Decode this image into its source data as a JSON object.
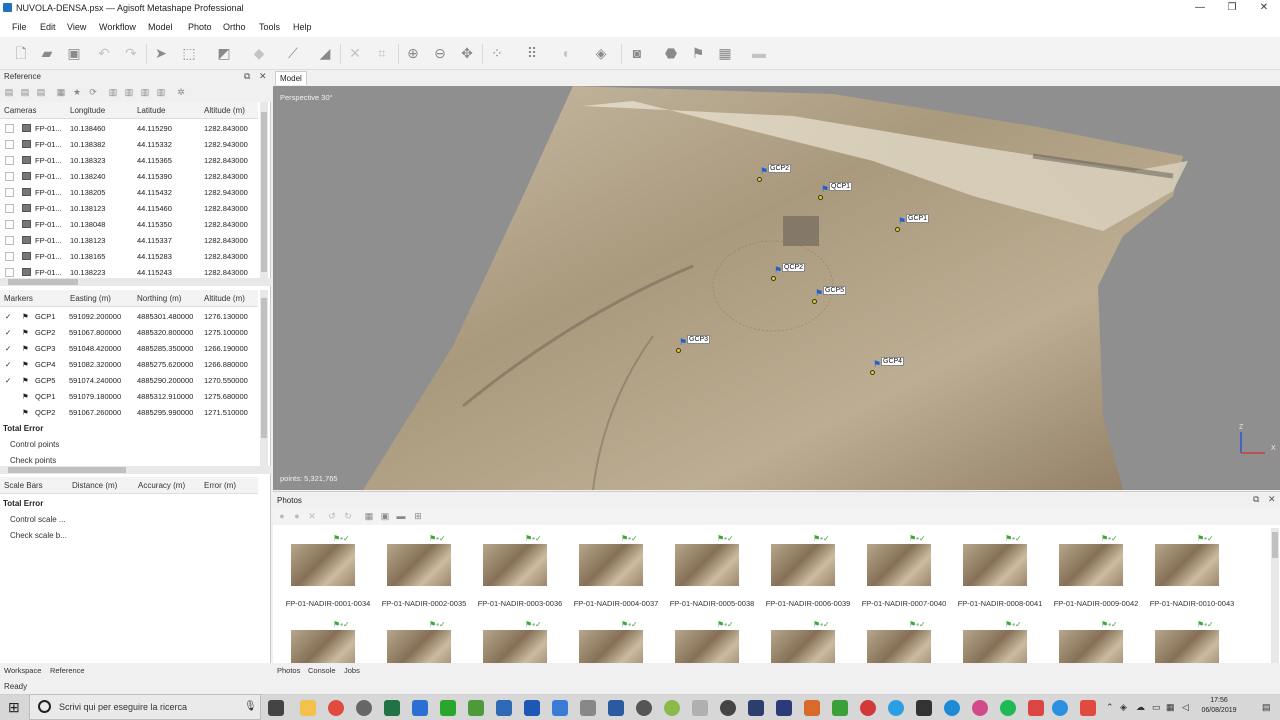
{
  "window": {
    "title": "NUVOLA-DENSA.psx — Agisoft Metashape Professional",
    "minimize": "—",
    "restore": "❐",
    "close": "✕"
  },
  "menu": [
    "File",
    "Edit",
    "View",
    "Workflow",
    "Model",
    "Photo",
    "Ortho",
    "Tools",
    "Help"
  ],
  "reference_panel": {
    "title": "Reference",
    "cameras": {
      "headers": [
        "Cameras",
        "Longitude",
        "Latitude",
        "Altitude (m)"
      ],
      "rows": [
        [
          "FP-01...",
          "10.138460",
          "44.115290",
          "1282.843000"
        ],
        [
          "FP-01...",
          "10.138382",
          "44.115332",
          "1282.943000"
        ],
        [
          "FP-01...",
          "10.138323",
          "44.115365",
          "1282.843000"
        ],
        [
          "FP-01...",
          "10.138240",
          "44.115390",
          "1282.843000"
        ],
        [
          "FP-01...",
          "10.138205",
          "44.115432",
          "1282.943000"
        ],
        [
          "FP-01...",
          "10.138123",
          "44.115460",
          "1282.843000"
        ],
        [
          "FP-01...",
          "10.138048",
          "44.115350",
          "1282.843000"
        ],
        [
          "FP-01...",
          "10.138123",
          "44.115337",
          "1282.843000"
        ],
        [
          "FP-01...",
          "10.138165",
          "44.115283",
          "1282.843000"
        ],
        [
          "FP-01...",
          "10.138223",
          "44.115243",
          "1282.843000"
        ]
      ]
    },
    "markers": {
      "headers": [
        "Markers",
        "Easting (m)",
        "Northing (m)",
        "Altitude (m)"
      ],
      "rows": [
        {
          "checked": true,
          "name": "GCP1",
          "easting": "591092.200000",
          "northing": "4885301.480000",
          "altitude": "1276.130000"
        },
        {
          "checked": true,
          "name": "GCP2",
          "easting": "591067.800000",
          "northing": "4885320.800000",
          "altitude": "1275.100000"
        },
        {
          "checked": true,
          "name": "GCP3",
          "easting": "591048.420000",
          "northing": "4885285.350000",
          "altitude": "1266.190000"
        },
        {
          "checked": true,
          "name": "GCP4",
          "easting": "591082.320000",
          "northing": "4885275.620000",
          "altitude": "1266.880000"
        },
        {
          "checked": true,
          "name": "GCP5",
          "easting": "591074.240000",
          "northing": "4885290.200000",
          "altitude": "1270.550000"
        },
        {
          "checked": false,
          "name": "QCP1",
          "easting": "591079.180000",
          "northing": "4885312.910000",
          "altitude": "1275.680000"
        },
        {
          "checked": false,
          "name": "QCP2",
          "easting": "591067.260000",
          "northing": "4885295.990000",
          "altitude": "1271.510000"
        }
      ],
      "total_error": "Total Error",
      "control_points": "Control points",
      "check_points": "Check points"
    },
    "scalebars": {
      "headers": [
        "Scale Bars",
        "Distance (m)",
        "Accuracy (m)",
        "Error (m)"
      ],
      "total_error": "Total Error",
      "control_scale": "Control scale ...",
      "check_scale": "Check scale b..."
    }
  },
  "left_tabs": [
    "Workspace",
    "Reference"
  ],
  "status": "Ready",
  "model": {
    "tab": "Model",
    "perspective": "Perspective 30°",
    "points": "points: 5,321,765",
    "axis_z": "Z",
    "axis_x": "X",
    "markers": [
      "GCP2",
      "QCP1",
      "GCP1",
      "QCP2",
      "GCP5",
      "GCP3",
      "GCP4"
    ]
  },
  "photos": {
    "title": "Photos",
    "thumbnails": [
      "FP-01-NADIR-0001-0034",
      "FP-01-NADIR-0002-0035",
      "FP-01-NADIR-0003-0036",
      "FP-01-NADIR-0004-0037",
      "FP-01-NADIR-0005-0038",
      "FP-01-NADIR-0006-0039",
      "FP-01-NADIR-0007-0040",
      "FP-01-NADIR-0008-0041",
      "FP-01-NADIR-0009-0042",
      "FP-01-NADIR-0010-0043"
    ],
    "tabs": [
      "Photos",
      "Console",
      "Jobs"
    ]
  },
  "taskbar": {
    "search_placeholder": "Scrivi qui per eseguire la ricerca",
    "time": "17:56",
    "date": "06/08/2019"
  }
}
